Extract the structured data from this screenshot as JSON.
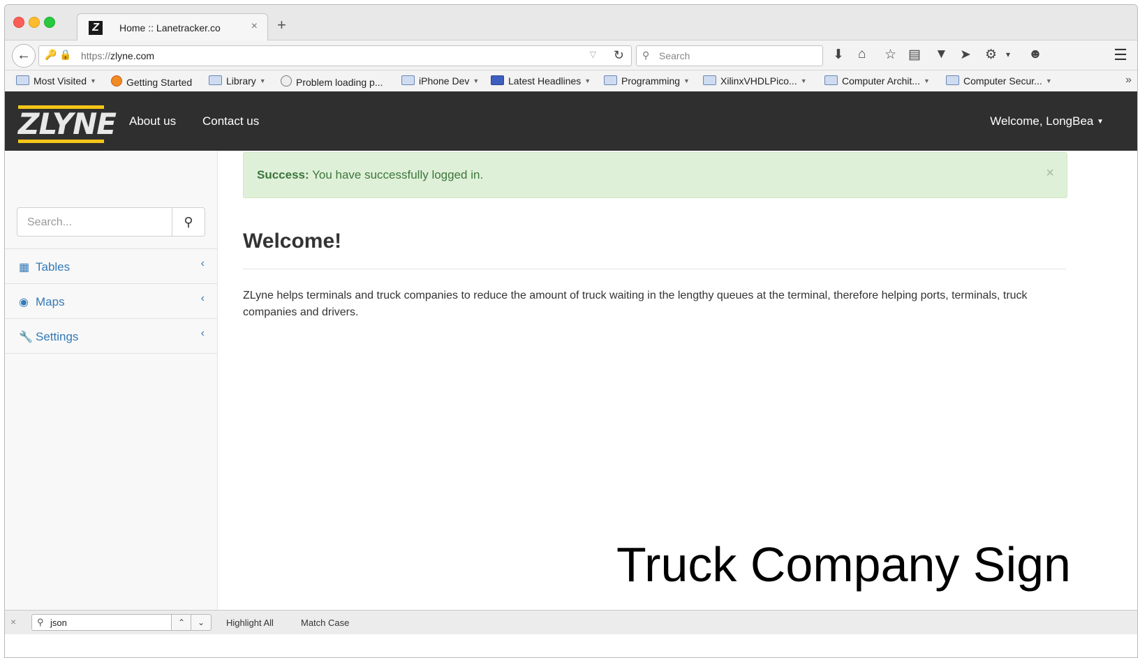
{
  "browser": {
    "tab_title": "Home :: Lanetracker.co",
    "tab_close": "×",
    "new_tab": "+",
    "url_scheme": "https://",
    "url_host": "zlyne.com",
    "search_placeholder": "Search",
    "bookmarks": [
      {
        "label": "Most Visited",
        "dropdown": true
      },
      {
        "label": "Getting Started",
        "dropdown": false
      },
      {
        "label": "Library",
        "dropdown": true
      },
      {
        "label": "Problem loading p...",
        "dropdown": false
      },
      {
        "label": "iPhone Dev",
        "dropdown": true
      },
      {
        "label": "Latest Headlines",
        "dropdown": true
      },
      {
        "label": "Programming",
        "dropdown": true
      },
      {
        "label": "XilinxVHDLPico...",
        "dropdown": true
      },
      {
        "label": "Computer Archit...",
        "dropdown": true
      },
      {
        "label": "Computer Secur...",
        "dropdown": true
      }
    ]
  },
  "site": {
    "logo_text": "ZLYNE",
    "nav": {
      "about": "About us",
      "contact": "Contact us"
    },
    "welcome_user": "Welcome, LongBea"
  },
  "sidebar": {
    "search_placeholder": "Search...",
    "items": [
      {
        "label": "Tables",
        "icon": "table-icon"
      },
      {
        "label": "Maps",
        "icon": "map-marker-icon"
      },
      {
        "label": "Settings",
        "icon": "wrench-icon"
      }
    ]
  },
  "main": {
    "alert_strong": "Success:",
    "alert_text": " You have successfully logged in.",
    "heading": "Welcome!",
    "paragraph": "ZLyne helps terminals and truck companies to reduce the amount of truck waiting in the lengthy queues at the terminal, therefore helping ports, terminals, truck companies and drivers."
  },
  "overlay_caption": "Truck Company Sign",
  "findbar": {
    "query": "json",
    "highlight_all": "Highlight All",
    "match_case": "Match Case"
  },
  "colors": {
    "header_bg": "#2f2f2f",
    "logo_accent": "#f5c518",
    "link_blue": "#337ab7",
    "alert_bg": "#dff0d8",
    "alert_text": "#3c763d"
  }
}
